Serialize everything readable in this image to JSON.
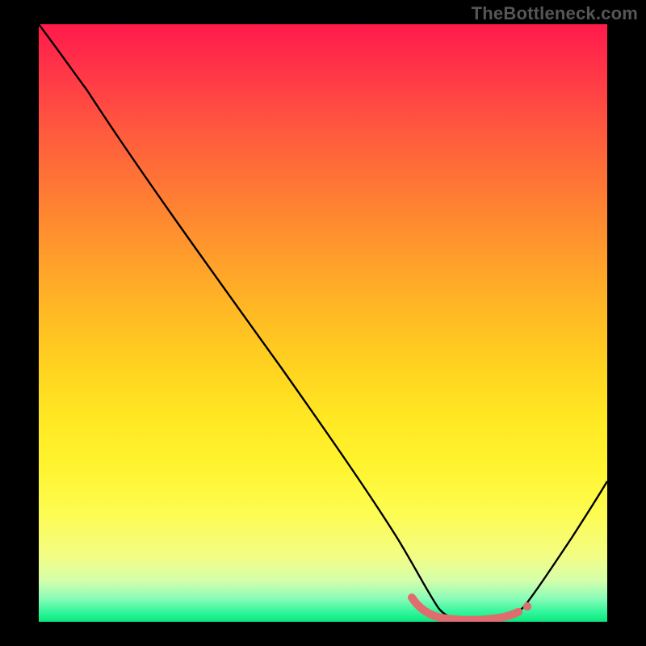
{
  "watermark": "TheBottleneck.com",
  "chart_data": {
    "type": "line",
    "title": "",
    "xlabel": "",
    "ylabel": "",
    "xlim": [
      0,
      100
    ],
    "ylim": [
      0,
      100
    ],
    "gradient_stops": [
      {
        "pct": 0,
        "color": "#ff1a4b"
      },
      {
        "pct": 8,
        "color": "#ff3647"
      },
      {
        "pct": 18,
        "color": "#ff5a3e"
      },
      {
        "pct": 28,
        "color": "#ff7a34"
      },
      {
        "pct": 38,
        "color": "#ff9a2c"
      },
      {
        "pct": 48,
        "color": "#ffb924"
      },
      {
        "pct": 58,
        "color": "#ffd420"
      },
      {
        "pct": 66,
        "color": "#ffe823"
      },
      {
        "pct": 74,
        "color": "#fff42f"
      },
      {
        "pct": 82,
        "color": "#fdfc52"
      },
      {
        "pct": 89,
        "color": "#f3fd84"
      },
      {
        "pct": 93,
        "color": "#d6feaa"
      },
      {
        "pct": 96,
        "color": "#8dfcb8"
      },
      {
        "pct": 98.5,
        "color": "#2ef59a"
      },
      {
        "pct": 100,
        "color": "#0be77e"
      }
    ],
    "series": [
      {
        "name": "bottleneck-curve",
        "color": "#000000",
        "points": [
          {
            "x": 0,
            "y": 100
          },
          {
            "x": 6,
            "y": 93
          },
          {
            "x": 10,
            "y": 88
          },
          {
            "x": 20,
            "y": 75
          },
          {
            "x": 30,
            "y": 61
          },
          {
            "x": 40,
            "y": 47
          },
          {
            "x": 50,
            "y": 33
          },
          {
            "x": 58,
            "y": 19
          },
          {
            "x": 63,
            "y": 9
          },
          {
            "x": 66,
            "y": 3
          },
          {
            "x": 69,
            "y": 0.8
          },
          {
            "x": 74,
            "y": 0.2
          },
          {
            "x": 79,
            "y": 0.4
          },
          {
            "x": 83,
            "y": 1.2
          },
          {
            "x": 86,
            "y": 4
          },
          {
            "x": 90,
            "y": 10
          },
          {
            "x": 95,
            "y": 18
          },
          {
            "x": 100,
            "y": 27
          }
        ]
      },
      {
        "name": "optimal-range-highlight",
        "color": "#e06d6d",
        "points": [
          {
            "x": 65.5,
            "y": 4.0
          },
          {
            "x": 67.5,
            "y": 1.8
          },
          {
            "x": 70,
            "y": 0.8
          },
          {
            "x": 72,
            "y": 0.4
          },
          {
            "x": 74,
            "y": 0.3
          },
          {
            "x": 76,
            "y": 0.3
          },
          {
            "x": 78,
            "y": 0.4
          },
          {
            "x": 80,
            "y": 0.6
          },
          {
            "x": 82,
            "y": 1.0
          },
          {
            "x": 83,
            "y": 1.4
          }
        ],
        "end_marker": {
          "x": 84.5,
          "y": 2.2
        }
      }
    ]
  }
}
